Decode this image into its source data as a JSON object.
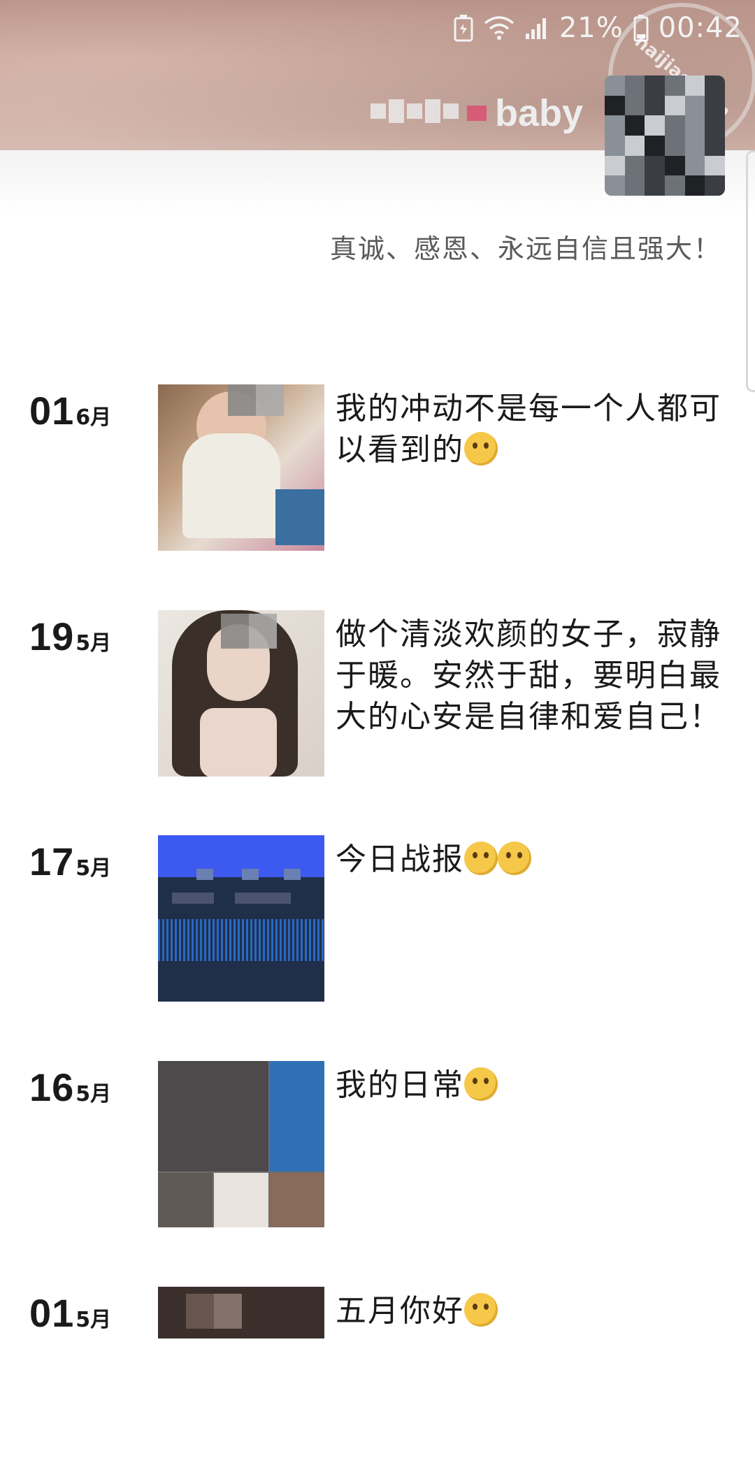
{
  "status_bar": {
    "battery_percent": "21%",
    "time": "00:42",
    "icons": [
      "battery-saver-icon",
      "wifi-icon",
      "signal-icon",
      "battery-icon"
    ]
  },
  "profile": {
    "nickname": "baby",
    "signature": "真诚、感恩、永远自信且强大！"
  },
  "watermark": "haijiao.com",
  "posts": [
    {
      "day": "01",
      "month": "6月",
      "caption": "我的冲动不是每一个人都可以看到的",
      "emoji": "thinking-emoji"
    },
    {
      "day": "19",
      "month": "5月",
      "caption": "做个清淡欢颜的女子，寂静于暖。安然于甜，要明白最大的心安是自律和爱自己！",
      "emoji": ""
    },
    {
      "day": "17",
      "month": "5月",
      "caption": "今日战报",
      "emoji": "smug-emoji"
    },
    {
      "day": "16",
      "month": "5月",
      "caption": "我的日常",
      "emoji": "facepalm-emoji"
    },
    {
      "day": "01",
      "month": "5月",
      "caption": "五月你好",
      "emoji": "smug-emoji"
    }
  ]
}
